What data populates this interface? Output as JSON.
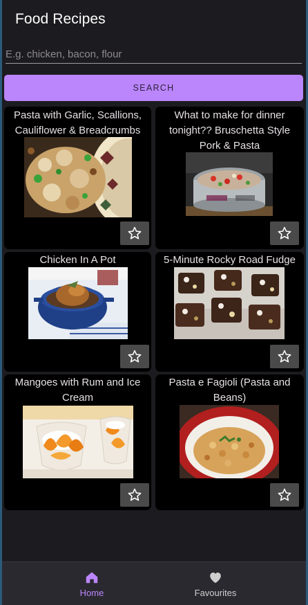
{
  "app": {
    "title": "Food Recipes"
  },
  "search": {
    "placeholder": "E.g. chicken, bacon, flour",
    "value": "",
    "button_label": "SEARCH"
  },
  "recipes": [
    {
      "title": "Pasta with Garlic, Scallions, Cauliflower & Breadcrumbs",
      "image": "pasta-garlic-photo",
      "favourite": false
    },
    {
      "title": "What to make for dinner tonight?? Bruschetta Style Pork & Pasta",
      "image": "bruschetta-pork-pasta-photo",
      "favourite": false
    },
    {
      "title": "Chicken In A Pot",
      "image": "chicken-pot-photo",
      "favourite": false
    },
    {
      "title": "5-Minute Rocky Road Fudge",
      "image": "rocky-road-fudge-photo",
      "favourite": false
    },
    {
      "title": "Mangoes with Rum and Ice Cream",
      "image": "mangoes-ice-cream-photo",
      "favourite": false
    },
    {
      "title": "Pasta e Fagioli (Pasta and Beans)",
      "image": "pasta-fagioli-photo",
      "favourite": false
    }
  ],
  "nav": {
    "items": [
      {
        "label": "Home",
        "icon": "home-icon",
        "active": true
      },
      {
        "label": "Favourites",
        "icon": "heart-icon",
        "active": false
      }
    ]
  },
  "colors": {
    "accent": "#bb86fc",
    "background": "#1c1b1f",
    "card": "#000000",
    "nav": "#2b2930"
  }
}
